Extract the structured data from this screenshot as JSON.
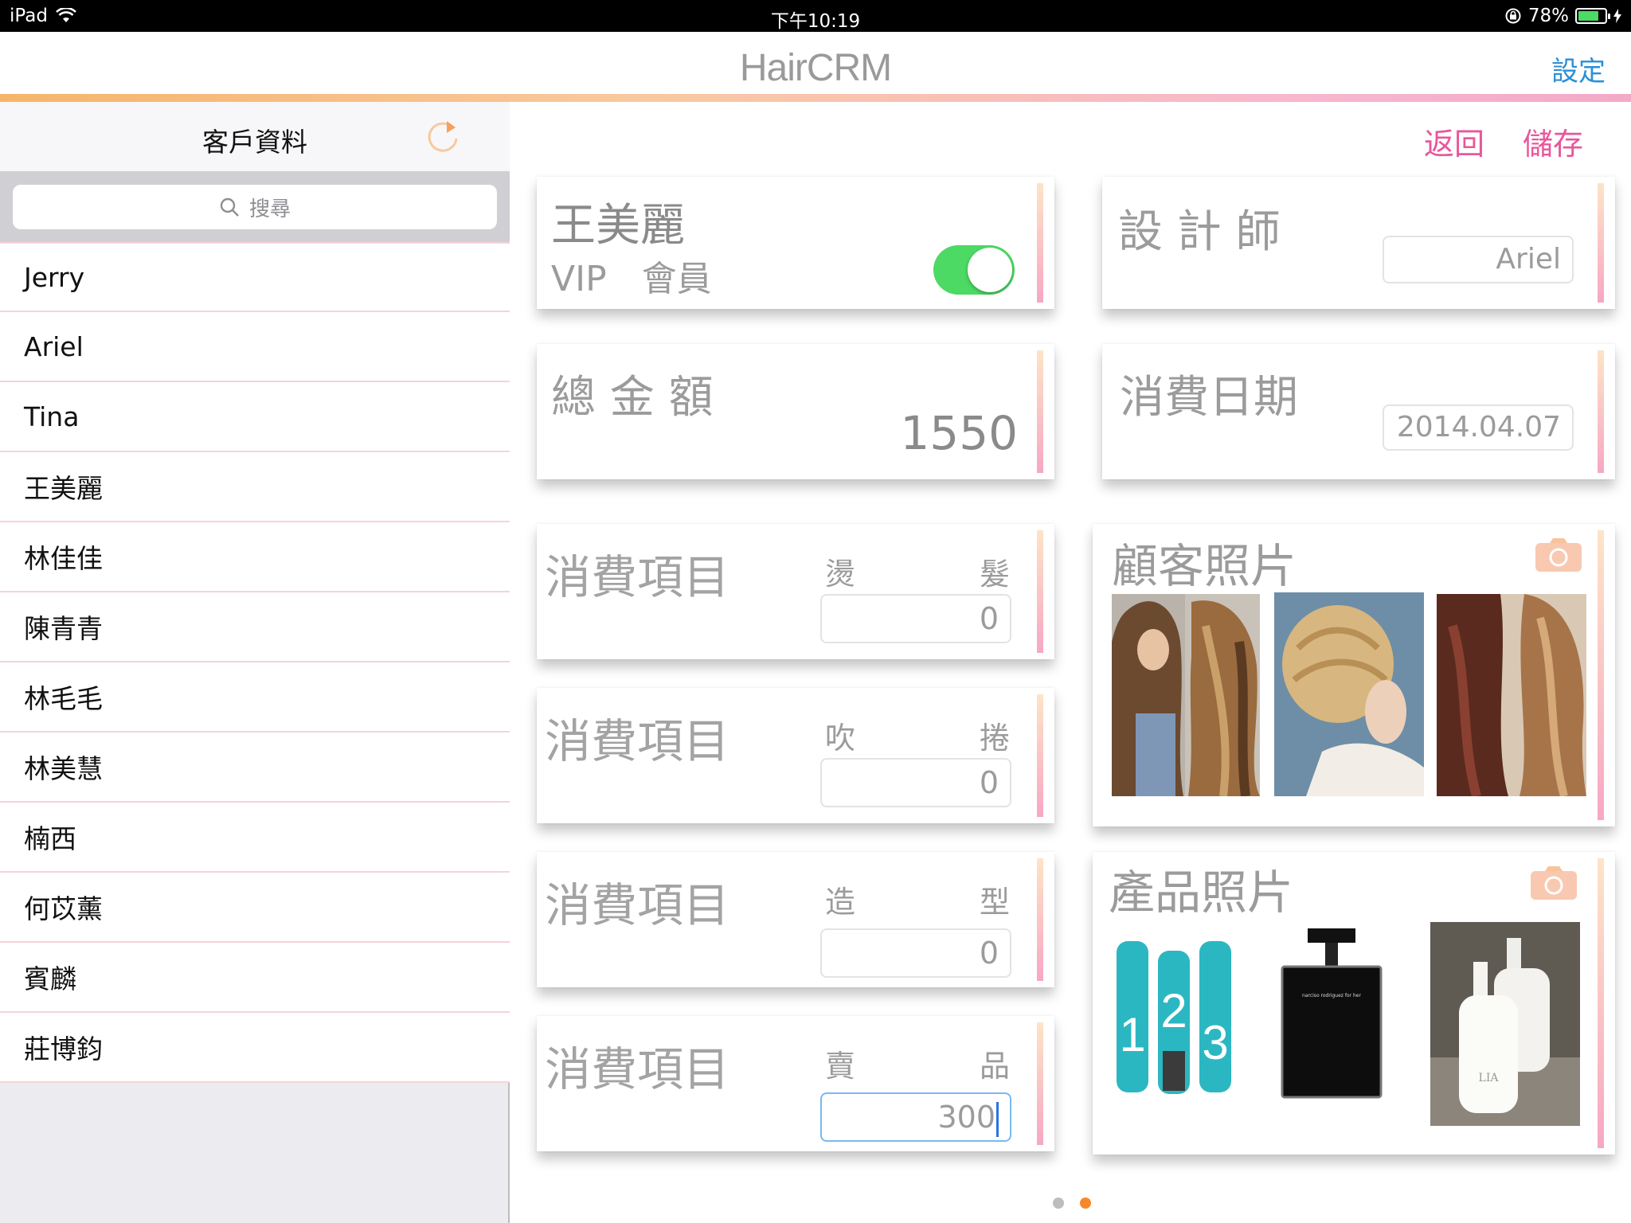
{
  "status_bar": {
    "device": "iPad",
    "time": "下午10:19",
    "battery": "78%",
    "battery_level": 0.78
  },
  "nav": {
    "title": "HairCRM",
    "settings": "設定"
  },
  "sidebar": {
    "title": "客戶資料",
    "search_placeholder": "搜尋",
    "customers": [
      "Jerry",
      "Ariel",
      "Tina",
      "王美麗",
      "林佳佳",
      "陳青青",
      "林毛毛",
      "林美慧",
      "楠西",
      "何苡薰",
      "賓麟",
      "莊博鈞"
    ]
  },
  "actions": {
    "back": "返回",
    "save": "儲存"
  },
  "customer": {
    "name": "王美麗",
    "vip_label": "VIP　會員",
    "vip_on": true
  },
  "designer": {
    "label": "設 計 師",
    "value": "Ariel"
  },
  "total": {
    "label": "總 金 額",
    "value": "1550"
  },
  "date": {
    "label": "消費日期",
    "value": "2014.04.07"
  },
  "items": [
    {
      "label": "消費項目",
      "type_a": "燙",
      "type_b": "髮",
      "value": "0"
    },
    {
      "label": "消費項目",
      "type_a": "吹",
      "type_b": "捲",
      "value": "0"
    },
    {
      "label": "消費項目",
      "type_a": "造",
      "type_b": "型",
      "value": "0"
    },
    {
      "label": "消費項目",
      "type_a": "賣",
      "type_b": "品",
      "value": "300"
    }
  ],
  "customer_photos": {
    "label": "顧客照片"
  },
  "product_photos": {
    "label": "產品照片",
    "bottle_brand": "LIA",
    "perfume_label": "narciso rodriguez for her"
  },
  "pager": {
    "count": 2,
    "current": 2
  },
  "colors": {
    "accent_pink": "#e8579a",
    "link_blue": "#2b8fd6",
    "toggle_green": "#4cd964",
    "camera_orange": "#f6b56a",
    "pager_active": "#f5892a"
  }
}
